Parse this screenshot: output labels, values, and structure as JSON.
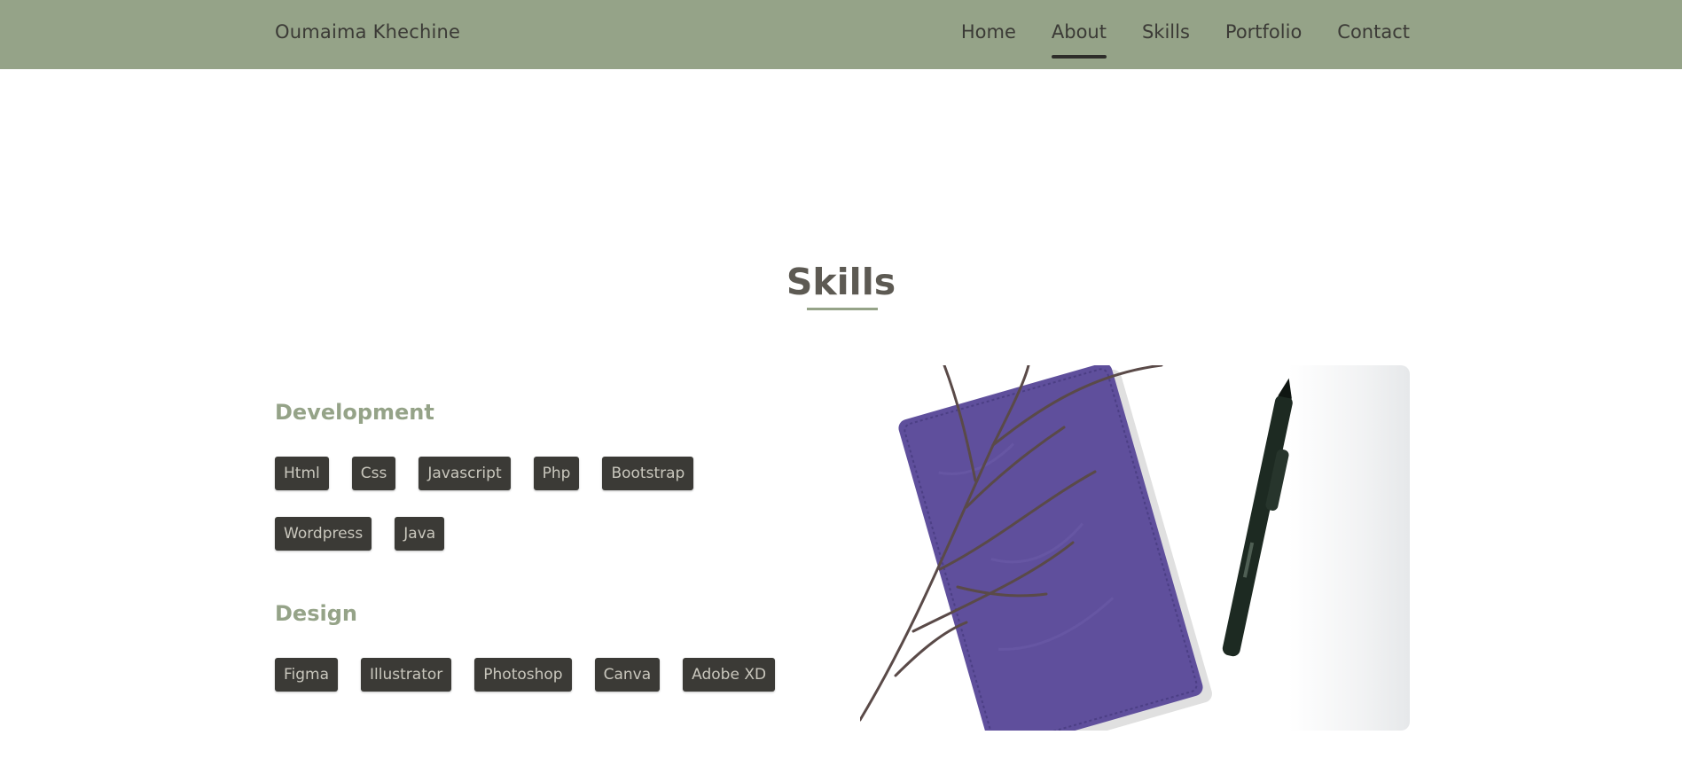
{
  "header": {
    "brand": "Oumaima Khechine",
    "nav": [
      "Home",
      "About",
      "Skills",
      "Portfolio",
      "Contact"
    ],
    "active": "About"
  },
  "skills": {
    "title": "Skills",
    "development": {
      "title": "Development",
      "row1": [
        "Html",
        "Css",
        "Javascript",
        "Php",
        "Bootstrap"
      ],
      "row2": [
        "Wordpress",
        "Java"
      ]
    },
    "design": {
      "title": "Design",
      "row1": [
        "Figma",
        "Illustrator",
        "Photoshop",
        "Canva",
        "Adobe XD"
      ]
    }
  },
  "colors": {
    "header_bg": "#95a388",
    "accent": "#95a388",
    "tag_bg": "#3b3a36",
    "tag_text": "#c9c7bd",
    "notebook": "#5f4f9c"
  },
  "image": {
    "icon": "notebook-pen-branch-photo"
  }
}
